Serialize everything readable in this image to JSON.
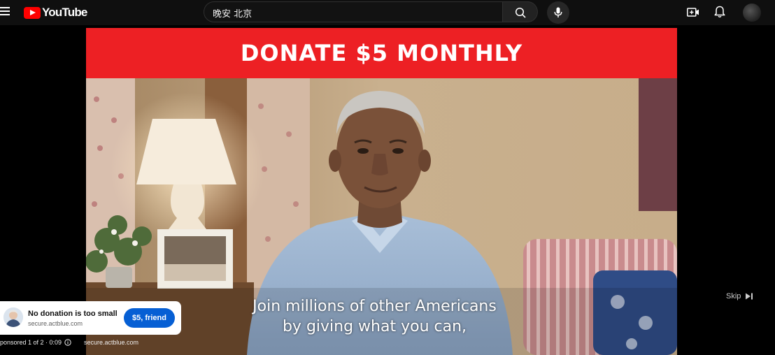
{
  "header": {
    "logo_text": "YouTube",
    "search": {
      "value": "晚安 北京",
      "placeholder": ""
    }
  },
  "icons": {
    "menu": "menu-icon",
    "search": "search-icon",
    "mic": "mic-icon",
    "create": "create-video-icon",
    "notifications": "bell-icon",
    "account": "avatar",
    "skip": "skip-next-icon",
    "info": "info-icon"
  },
  "colors": {
    "brand_red": "#ff0000",
    "banner_red": "#ed2024",
    "cta_blue": "#065fd4"
  },
  "video": {
    "banner_text": "DONATE $5 MONTHLY",
    "caption_lines": [
      "Join millions of other Americans",
      "by giving what you can,"
    ],
    "skip_label": "Skip"
  },
  "ad": {
    "title": "No donation is too small",
    "domain": "secure.actblue.com",
    "cta_label": "$5, friend",
    "status": "ponsored 1 of 2 · 0:09",
    "status_domain": "secure.actblue.com"
  }
}
